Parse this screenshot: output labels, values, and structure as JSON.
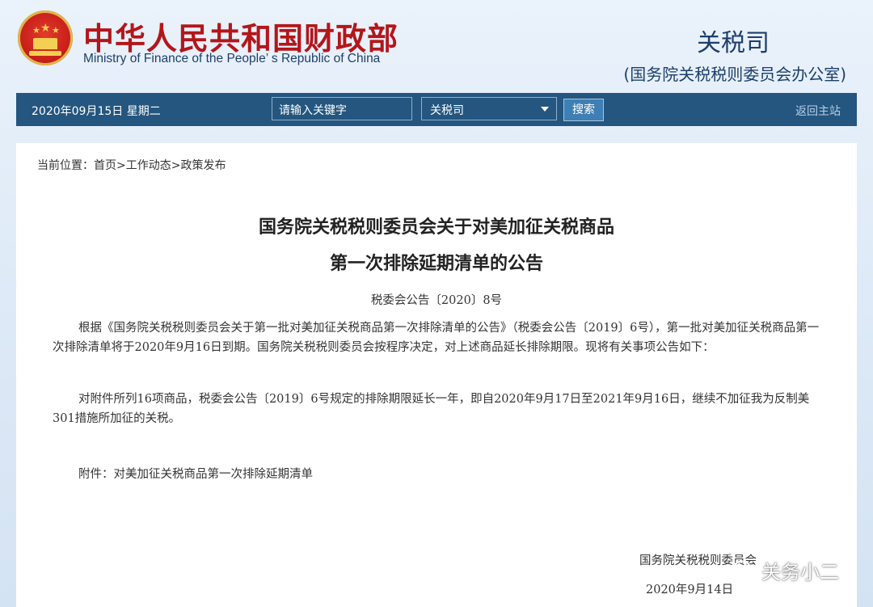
{
  "header": {
    "ministry_cn": "中华人民共和国财政部",
    "ministry_en": "Ministry of Finance of the People’ s Republic of China",
    "dept_name": "关税司",
    "dept_sub": "(国务院关税税则委员会办公室)"
  },
  "navbar": {
    "date": "2020年09月15日  星期二",
    "search_placeholder": "请输入关键字",
    "select_value": "关税司",
    "search_button": "搜索",
    "home_link": "返回主站"
  },
  "breadcrumb": {
    "prefix": "当前位置：",
    "items": [
      "首页",
      "工作动态",
      "政策发布"
    ],
    "separator": ">"
  },
  "article": {
    "title_line1": "国务院关税税则委员会关于对美加征关税商品",
    "title_line2": "第一次排除延期清单的公告",
    "doc_number": "税委会公告〔2020〕8号",
    "paragraphs": [
      "根据《国务院关税税则委员会关于第一批对美加征关税商品第一次排除清单的公告》（税委会公告〔2019〕6号），第一批对美加征关税商品第一次排除清单将于2020年9月16日到期。国务院关税税则委员会按程序决定，对上述商品延长排除期限。现将有关事项公告如下：",
      "对附件所列16项商品，税委会公告〔2019〕6号规定的排除期限延长一年，即自2020年9月17日至2021年9月16日，继续不加征我为反制美301措施所加征的关税。"
    ],
    "attachment": "附件：对美加征关税商品第一次排除延期清单",
    "signature_org": "国务院关税税则委员会",
    "signature_date": "2020年9月14日"
  },
  "watermark": {
    "text": "关务小二",
    "icon": "wechat-icon"
  },
  "colors": {
    "navbar": "#24567f",
    "ministry_red": "#b3161a",
    "dept_blue": "#1d3f6b"
  }
}
